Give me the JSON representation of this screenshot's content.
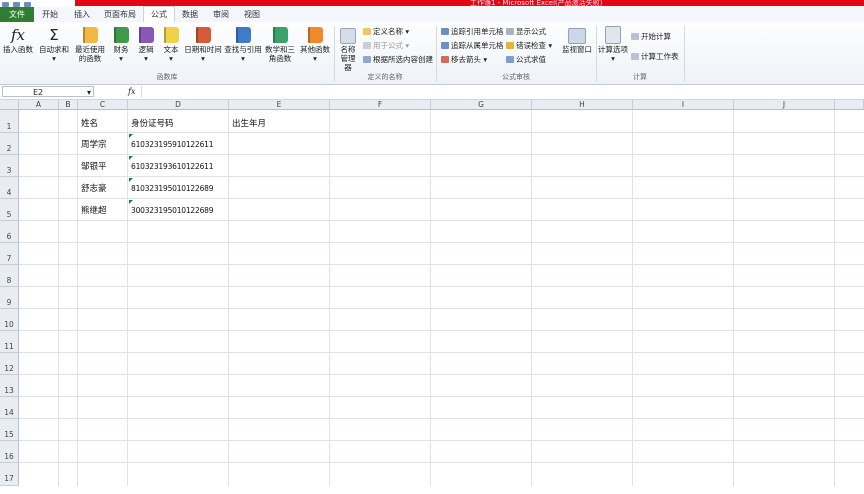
{
  "title": "工作簿1 - Microsoft Excel(产品激活失败)",
  "tabs": [
    "文件",
    "开始",
    "插入",
    "页面布局",
    "公式",
    "数据",
    "审阅",
    "视图"
  ],
  "active_tab": "公式",
  "ribbon": {
    "insert_function": "插入函数",
    "autosum": "自动求和",
    "recent": "最近使用的函数",
    "financial": "财务",
    "logical": "逻辑",
    "text": "文本",
    "datetime": "日期和时间",
    "lookup": "查找与引用",
    "math": "数学和三角函数",
    "other": "其他函数",
    "group_library": "函数库",
    "name_manager": "名称管理器",
    "define_name": "定义名称",
    "use_in_formula": "用于公式",
    "create_from_selection": "根据所选内容创建",
    "group_names": "定义的名称",
    "trace_precedents": "追踪引用单元格",
    "trace_dependents": "追踪从属单元格",
    "remove_arrows": "移去箭头",
    "show_formulas": "显示公式",
    "error_checking": "错误检查",
    "evaluate_formula": "公式求值",
    "group_auditing": "公式审核",
    "watch_window": "监视窗口",
    "calc_options": "计算选项",
    "calc_now": "开始计算",
    "calc_sheet": "计算工作表",
    "group_calc": "计算"
  },
  "formula_bar": {
    "name_box": "E2",
    "fx": "fx",
    "content": ""
  },
  "columns": [
    "A",
    "B",
    "C",
    "D",
    "E",
    "F",
    "G",
    "H",
    "I",
    "J"
  ],
  "rows": [
    "1",
    "2",
    "3",
    "4",
    "5",
    "6",
    "7",
    "8",
    "9",
    "10",
    "11",
    "12",
    "13",
    "14",
    "15",
    "16",
    "17"
  ],
  "cells": {
    "C1": "姓名",
    "D1": "身份证号码",
    "E1": "出生年月",
    "C2": "周学宗",
    "D2": "610323195910122611",
    "C3": "邹银平",
    "D3": "610323193610122611",
    "C4": "舒志豪",
    "D4": "810323195010122689",
    "C5": "熊继超",
    "D5": "300323195010122689"
  },
  "colors": {
    "file_tab": "#2f7d33",
    "title_bar": "#e30613",
    "selection": "#222222"
  }
}
